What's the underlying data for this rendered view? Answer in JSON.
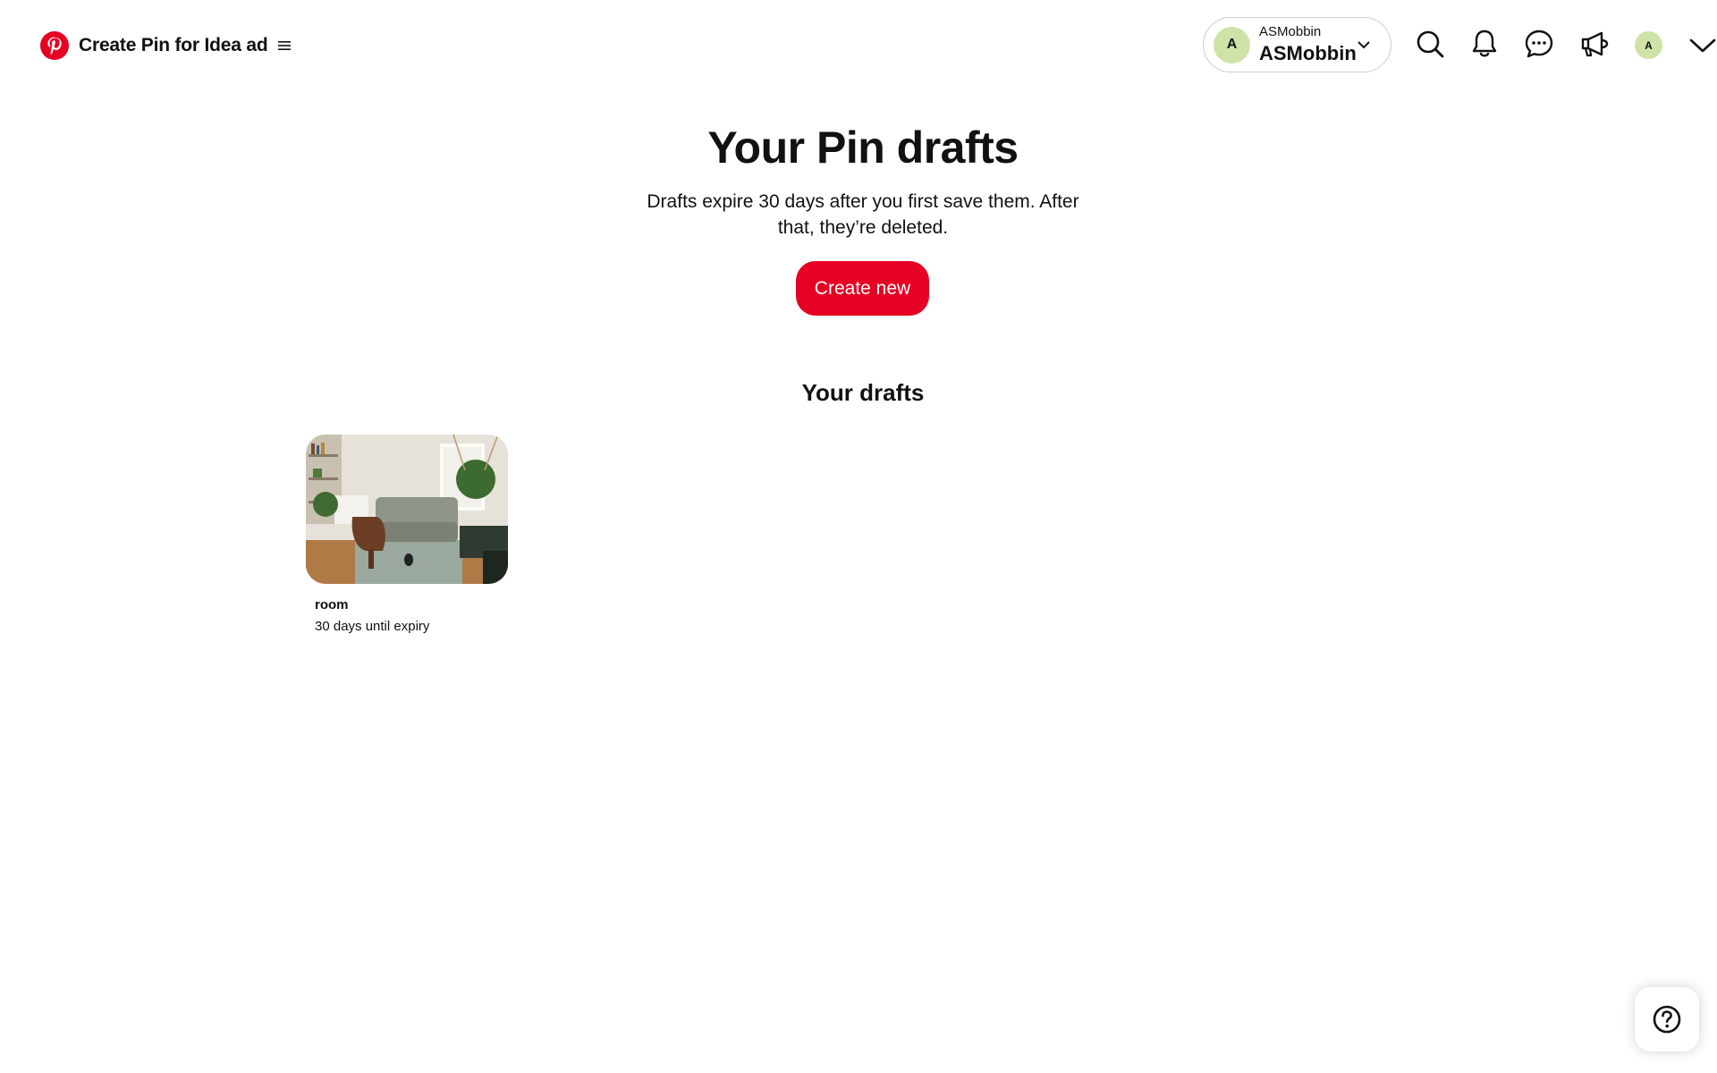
{
  "header": {
    "app_title": "Create Pin for Idea ad",
    "logo_icon": "pinterest-logo",
    "menu_icon": "hamburger-icon",
    "brand_color": "#e60023"
  },
  "account": {
    "avatar_initial": "A",
    "name_small": "ASMobbin",
    "name_large": "ASMobbin",
    "avatar_color": "#cfe3a8"
  },
  "nav_icons": [
    "search-icon",
    "bell-icon",
    "chat-icon",
    "megaphone-icon"
  ],
  "profile": {
    "avatar_initial": "A"
  },
  "main": {
    "title": "Your Pin drafts",
    "subtitle": "Drafts expire 30 days after you first save them. After that, they’re deleted.",
    "create_button": "Create new",
    "section_title": "Your drafts"
  },
  "drafts": [
    {
      "title": "room",
      "expiry": "30 days until expiry"
    }
  ],
  "help": {
    "icon": "question-icon"
  }
}
